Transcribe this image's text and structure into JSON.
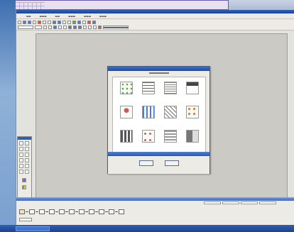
{
  "colors": {
    "titlebar": "#1a449a",
    "taskbar": "#2f5fb6",
    "canvas": "#cbcac5",
    "accent_red": "#d9534f",
    "accent_blue": "#4a7bd0",
    "accent_green": "#5cab4a"
  },
  "toolbar": {
    "row1_icons": [
      "new-icon",
      "open-icon",
      "save-icon",
      "print-icon",
      "cut-icon",
      "copy-icon",
      "paste-icon",
      "undo-icon",
      "redo-icon",
      "zoom-in-icon",
      "zoom-out-icon",
      "grid-icon",
      "link-icon",
      "table-icon",
      "chart-icon",
      "help-icon"
    ],
    "row2_icons": [
      "pointer-icon",
      "text-icon",
      "line-icon",
      "rect-icon",
      "ellipse-icon",
      "align-left-icon",
      "align-center-icon",
      "align-right-icon",
      "bold-icon",
      "italic-icon",
      "underline-icon",
      "color-icon"
    ]
  },
  "dialog": {
    "tiles": [
      "template-icon-1",
      "template-icon-2",
      "template-icon-3",
      "template-icon-4",
      "template-icon-5",
      "template-icon-6",
      "template-icon-7",
      "template-icon-8",
      "template-icon-9",
      "template-icon-10",
      "template-icon-11",
      "template-icon-12"
    ]
  }
}
